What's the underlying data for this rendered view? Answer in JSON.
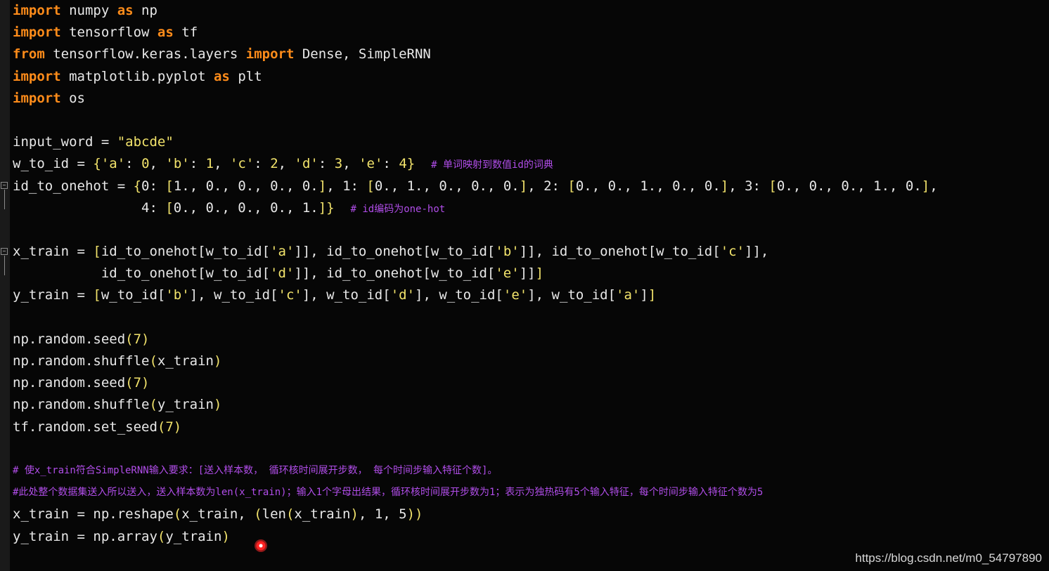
{
  "code_lines": [
    [
      {
        "t": "import",
        "c": "kw"
      },
      {
        "t": " numpy "
      },
      {
        "t": "as",
        "c": "kw"
      },
      {
        "t": " np"
      }
    ],
    [
      {
        "t": "import",
        "c": "kw"
      },
      {
        "t": " tensorflow "
      },
      {
        "t": "as",
        "c": "kw"
      },
      {
        "t": " tf"
      }
    ],
    [
      {
        "t": "from",
        "c": "kw"
      },
      {
        "t": " tensorflow.keras.layers "
      },
      {
        "t": "import",
        "c": "kw"
      },
      {
        "t": " Dense, SimpleRNN"
      }
    ],
    [
      {
        "t": "import",
        "c": "kw"
      },
      {
        "t": " matplotlib.pyplot "
      },
      {
        "t": "as",
        "c": "kw"
      },
      {
        "t": " plt"
      }
    ],
    [
      {
        "t": "import",
        "c": "kw"
      },
      {
        "t": " os"
      }
    ],
    [],
    [
      {
        "t": "input_word = "
      },
      {
        "t": "\"abcde\"",
        "c": "str"
      }
    ],
    [
      {
        "t": "w_to_id = "
      },
      {
        "t": "{",
        "c": "br"
      },
      {
        "t": "'a'",
        "c": "str"
      },
      {
        "t": ": "
      },
      {
        "t": "0",
        "c": "num"
      },
      {
        "t": ", "
      },
      {
        "t": "'b'",
        "c": "str"
      },
      {
        "t": ": "
      },
      {
        "t": "1",
        "c": "num"
      },
      {
        "t": ", "
      },
      {
        "t": "'c'",
        "c": "str"
      },
      {
        "t": ": "
      },
      {
        "t": "2",
        "c": "num"
      },
      {
        "t": ", "
      },
      {
        "t": "'d'",
        "c": "str"
      },
      {
        "t": ": "
      },
      {
        "t": "3",
        "c": "num"
      },
      {
        "t": ", "
      },
      {
        "t": "'e'",
        "c": "str"
      },
      {
        "t": ": "
      },
      {
        "t": "4",
        "c": "num"
      },
      {
        "t": "}",
        "c": "br"
      },
      {
        "t": "  "
      },
      {
        "t": "# 单词映射到数值id的词典",
        "c": "cmt"
      }
    ],
    [
      {
        "t": "id_to_onehot = "
      },
      {
        "t": "{",
        "c": "br"
      },
      {
        "t": "0: "
      },
      {
        "t": "[",
        "c": "br"
      },
      {
        "t": "1., 0., 0., 0., 0."
      },
      {
        "t": "]",
        "c": "br"
      },
      {
        "t": ", 1: "
      },
      {
        "t": "[",
        "c": "br"
      },
      {
        "t": "0., 1., 0., 0., 0."
      },
      {
        "t": "]",
        "c": "br"
      },
      {
        "t": ", 2: "
      },
      {
        "t": "[",
        "c": "br"
      },
      {
        "t": "0., 0., 1., 0., 0."
      },
      {
        "t": "]",
        "c": "br"
      },
      {
        "t": ", 3: "
      },
      {
        "t": "[",
        "c": "br"
      },
      {
        "t": "0., 0., 0., 1., 0."
      },
      {
        "t": "]",
        "c": "br"
      },
      {
        "t": ","
      }
    ],
    [
      {
        "t": "                4: "
      },
      {
        "t": "[",
        "c": "br"
      },
      {
        "t": "0., 0., 0., 0., 1."
      },
      {
        "t": "]}",
        "c": "br"
      },
      {
        "t": "  "
      },
      {
        "t": "# id编码为one-hot",
        "c": "cmt"
      }
    ],
    [],
    [
      {
        "t": "x_train = "
      },
      {
        "t": "[",
        "c": "br"
      },
      {
        "t": "id_to_onehot[w_to_id["
      },
      {
        "t": "'a'",
        "c": "str"
      },
      {
        "t": "]], id_to_onehot[w_to_id["
      },
      {
        "t": "'b'",
        "c": "str"
      },
      {
        "t": "]], id_to_onehot[w_to_id["
      },
      {
        "t": "'c'",
        "c": "str"
      },
      {
        "t": "]],"
      }
    ],
    [
      {
        "t": "           id_to_onehot[w_to_id["
      },
      {
        "t": "'d'",
        "c": "str"
      },
      {
        "t": "]], id_to_onehot[w_to_id["
      },
      {
        "t": "'e'",
        "c": "str"
      },
      {
        "t": "]]"
      },
      {
        "t": "]",
        "c": "br"
      }
    ],
    [
      {
        "t": "y_train = "
      },
      {
        "t": "[",
        "c": "br"
      },
      {
        "t": "w_to_id["
      },
      {
        "t": "'b'",
        "c": "str"
      },
      {
        "t": "], w_to_id["
      },
      {
        "t": "'c'",
        "c": "str"
      },
      {
        "t": "], w_to_id["
      },
      {
        "t": "'d'",
        "c": "str"
      },
      {
        "t": "], w_to_id["
      },
      {
        "t": "'e'",
        "c": "str"
      },
      {
        "t": "], w_to_id["
      },
      {
        "t": "'a'",
        "c": "str"
      },
      {
        "t": "]"
      },
      {
        "t": "]",
        "c": "br"
      }
    ],
    [],
    [
      {
        "t": "np.random.seed"
      },
      {
        "t": "(7)",
        "c": "br"
      }
    ],
    [
      {
        "t": "np.random.shuffle"
      },
      {
        "t": "(",
        "c": "br"
      },
      {
        "t": "x_train"
      },
      {
        "t": ")",
        "c": "br"
      }
    ],
    [
      {
        "t": "np.random.seed"
      },
      {
        "t": "(7)",
        "c": "br"
      }
    ],
    [
      {
        "t": "np.random.shuffle"
      },
      {
        "t": "(",
        "c": "br"
      },
      {
        "t": "y_train"
      },
      {
        "t": ")",
        "c": "br"
      }
    ],
    [
      {
        "t": "tf.random.set_seed"
      },
      {
        "t": "(7)",
        "c": "br"
      }
    ],
    [],
    [
      {
        "t": "# 使x_train符合SimpleRNN输入要求：[送入样本数， 循环核时间展开步数， 每个时间步输入特征个数]。",
        "c": "cmt"
      }
    ],
    [
      {
        "t": "#此处整个数据集送入所以送入，送入样本数为len(x_train)；输入1个字母出结果，循环核时间展开步数为1；表示为独热码有5个输入特征，每个时间步输入特征个数为5",
        "c": "cmt"
      }
    ],
    [
      {
        "t": "x_train = np.reshape"
      },
      {
        "t": "(",
        "c": "br"
      },
      {
        "t": "x_train, "
      },
      {
        "t": "(",
        "c": "br"
      },
      {
        "t": "len"
      },
      {
        "t": "(",
        "c": "br"
      },
      {
        "t": "x_train"
      },
      {
        "t": ")",
        "c": "br"
      },
      {
        "t": ", 1, 5"
      },
      {
        "t": "))",
        "c": "br"
      }
    ],
    [
      {
        "t": "y_train = np.array"
      },
      {
        "t": "(",
        "c": "br"
      },
      {
        "t": "y_train"
      },
      {
        "t": ")",
        "c": "br"
      }
    ]
  ],
  "watermark": "https://blog.csdn.net/m0_54797890"
}
